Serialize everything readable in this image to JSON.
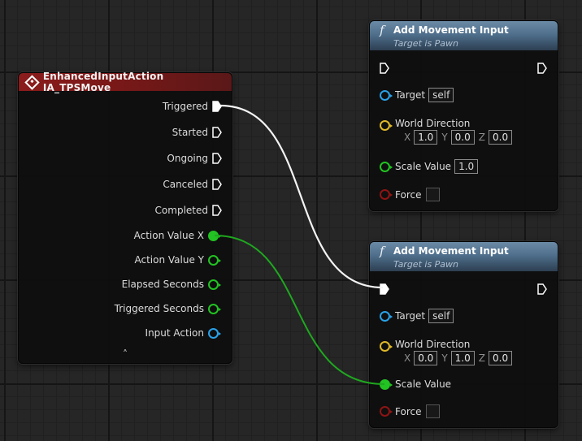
{
  "event_node": {
    "title": "EnhancedInputAction IA_TPSMove",
    "header_color": "#8a1c1c",
    "exec_pins": [
      "Triggered",
      "Started",
      "Ongoing",
      "Canceled",
      "Completed"
    ],
    "data_pins": [
      {
        "label": "Action Value X",
        "color": "#22c322"
      },
      {
        "label": "Action Value Y",
        "color": "#22c322"
      },
      {
        "label": "Elapsed Seconds",
        "color": "#22c322"
      },
      {
        "label": "Triggered Seconds",
        "color": "#22c322"
      },
      {
        "label": "Input Action",
        "color": "#2aa1e8"
      }
    ],
    "collapse_symbol": "˄"
  },
  "movement_nodes": [
    {
      "title": "Add Movement Input",
      "subtitle": "Target is Pawn",
      "function_glyph": "f",
      "target_label": "Target",
      "target_value": "self",
      "direction_label": "World Direction",
      "x_label": "X",
      "x_value": "1.0",
      "y_label": "Y",
      "y_value": "0.0",
      "z_label": "Z",
      "z_value": "0.0",
      "scale_label": "Scale Value",
      "scale_value": "1.0",
      "force_label": "Force"
    },
    {
      "title": "Add Movement Input",
      "subtitle": "Target is Pawn",
      "function_glyph": "f",
      "target_label": "Target",
      "target_value": "self",
      "direction_label": "World Direction",
      "x_label": "X",
      "x_value": "0.0",
      "y_label": "Y",
      "y_value": "1.0",
      "z_label": "Z",
      "z_value": "0.0",
      "scale_label": "Scale Value",
      "force_label": "Force"
    }
  ],
  "colors": {
    "exec_wire": "#ffffff",
    "float_wire": "#22b022",
    "object_pin": "#2aa1e8",
    "vector_pin": "#e0b82a",
    "float_pin": "#22c322",
    "bool_pin": "#8f1414",
    "header_blue": "#4f6f8c"
  }
}
